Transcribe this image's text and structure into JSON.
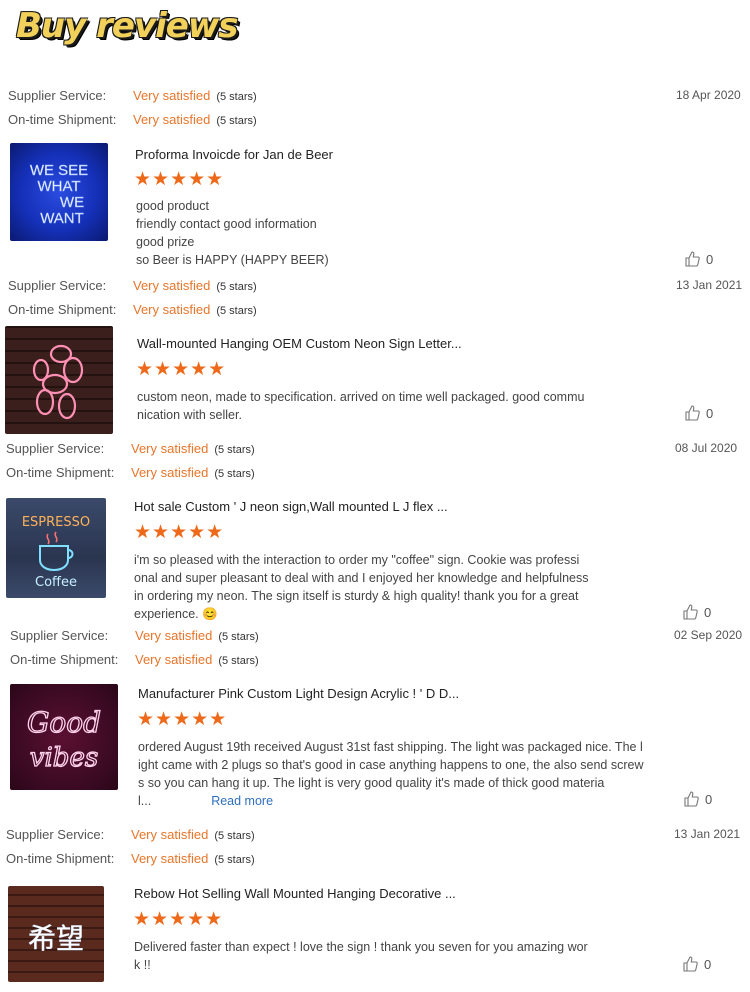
{
  "banner": {
    "title": "Buy reviews"
  },
  "labels": {
    "supplier": "Supplier Service:",
    "shipment": "On-time Shipment:",
    "rating_text": "Very satisfied",
    "stars_text": "(5 stars)"
  },
  "reviews": [
    {
      "date": "18 Apr 2020",
      "title": "Proforma Invoicde for Jan de Beer",
      "stars": "★★★★★",
      "lines": [
        "good product",
        "friendly contact good information",
        "good prize",
        "so Beer is HAPPY (HAPPY BEER)"
      ],
      "likes": "0",
      "image": "We see what we want neon"
    },
    {
      "date": "13 Jan 2021",
      "title": "Wall-mounted Hanging OEM Custom Neon Sign Letter...",
      "stars": "★★★★★",
      "lines": [
        "custom neon, made to specification. arrived on time well packaged. good commu",
        "nication with seller."
      ],
      "likes": "0",
      "image": "balloon dog neon"
    },
    {
      "date": "08 Jul 2020",
      "title": "Hot sale Custom '  J neon sign,Wall mounted L  J flex ...",
      "stars": "★★★★★",
      "lines": [
        "i'm so pleased with the interaction to order my \"coffee\" sign. Cookie was professi",
        "onal and super pleasant to deal with and I enjoyed her knowledge and helpfulness",
        "in ordering my neon. The sign itself is sturdy & high quality!  thank you for a great",
        "experience. 😊"
      ],
      "likes": "0",
      "image": "espresso coffee neon"
    },
    {
      "date": "02 Sep 2020",
      "title": "Manufacturer Pink Custom Light Design Acrylic ! '  D D...",
      "stars": "★★★★★",
      "lines": [
        "ordered August 19th received August 31st fast shipping. The light was packaged nice. The l",
        "ight came with 2 plugs so that's good in case anything happens to one, the also send screw",
        "s so you can hang it up. The light is very good quality it's made of thick good materia",
        "l..."
      ],
      "read_more": "Read more",
      "likes": "0",
      "image": "Good vibes neon"
    },
    {
      "date": "13 Jan 2021",
      "title": "Rebow Hot Selling Wall Mounted Hanging Decorative ...",
      "stars": "★★★★★",
      "lines": [
        "Delivered faster than expect ! love the sign ! thank you seven for you amazing wor",
        "k !!"
      ],
      "likes": "0",
      "image": "希望 neon"
    }
  ]
}
